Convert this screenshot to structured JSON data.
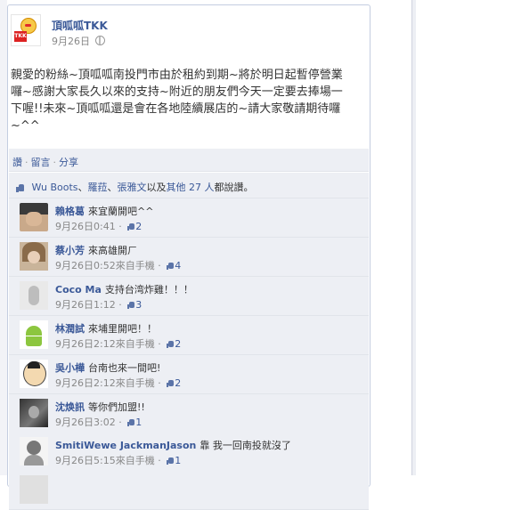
{
  "post": {
    "page_name": "頂呱呱TKK",
    "time": "9月26日",
    "text": "親愛的粉絲~頂呱呱南投門市由於租約到期~將於明日起暫停營業囉~感謝大家長久以來的支持~附近的朋友們今天一定要去捧場一下喔!!未來~頂呱呱還是會在各地陸續展店的~請大家敬請期待囉~^^",
    "avatar_text": "TKK"
  },
  "actions": {
    "like": "讚",
    "comment": "留言",
    "share": "分享",
    "separator": "·"
  },
  "likes": {
    "name1": "Wu Boots",
    "sep1": "、",
    "name2": "羅菈",
    "sep2": "、",
    "name3": "張雅文",
    "middle": "以及",
    "others": "其他 27 人",
    "suffix": "都說讚。"
  },
  "comments": [
    {
      "name": "賴格葛",
      "text": "來宜蘭開吧^^",
      "time": "9月26日0:41",
      "via": "",
      "likes": "2"
    },
    {
      "name": "蔡小芳",
      "text": "來高雄開ㄏ",
      "time": "9月26日0:52",
      "via": "來自手機",
      "likes": "4"
    },
    {
      "name": "Coco Ma",
      "text": "支持台湾炸雞！！！",
      "time": "9月26日1:12",
      "via": "",
      "likes": "3"
    },
    {
      "name": "林潤試",
      "text": "來埔里開吧！！",
      "time": "9月26日2:12",
      "via": "來自手機",
      "likes": "2"
    },
    {
      "name": "吳小樺",
      "text": "台南也來一間吧!",
      "time": "9月26日2:12",
      "via": "來自手機",
      "likes": "2"
    },
    {
      "name": "沈焕訊",
      "text": "等你們加盟!!",
      "time": "9月26日3:02",
      "via": "",
      "likes": "1"
    },
    {
      "name": "SmitiWewe JackmanJason",
      "text": "靠 我一回南投就沒了",
      "time": "9月26日5:15",
      "via": "來自手機",
      "likes": "1"
    },
    {
      "name": "",
      "text": "",
      "time": "",
      "via": "",
      "likes": ""
    }
  ],
  "colors": {
    "link": "#3b5998",
    "comment_bg": "#edeff4",
    "border": "#c4cde0"
  }
}
